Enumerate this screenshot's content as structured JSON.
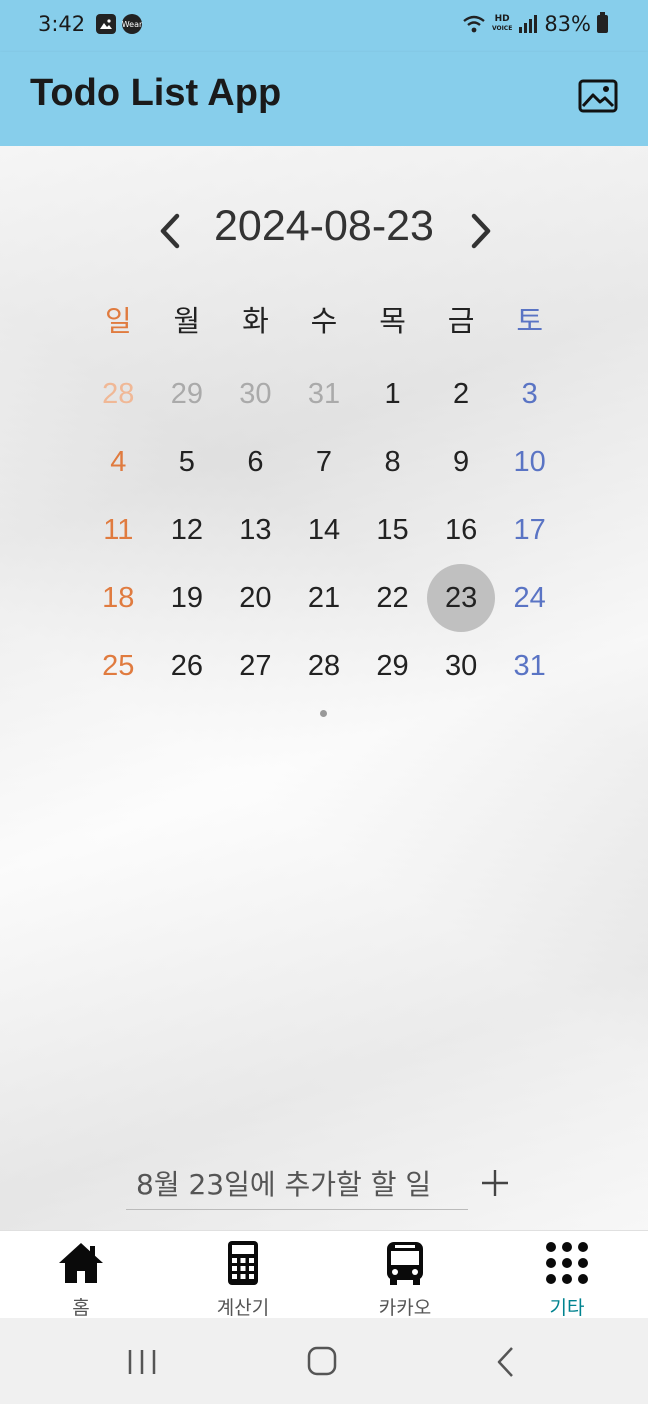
{
  "status_bar": {
    "time": "3:42",
    "battery": "83%",
    "left_icons": [
      "gallery-icon",
      "wear-icon"
    ],
    "wear_label": "Wear",
    "hd_label": "HD",
    "voice_label": "VOICE"
  },
  "app_bar": {
    "title": "Todo List App",
    "action_icon": "image-icon"
  },
  "calendar": {
    "current_date": "2024-08-23",
    "weekdays": [
      "일",
      "월",
      "화",
      "수",
      "목",
      "금",
      "토"
    ],
    "weeks": [
      [
        "28",
        "29",
        "30",
        "31",
        "1",
        "2",
        "3"
      ],
      [
        "4",
        "5",
        "6",
        "7",
        "8",
        "9",
        "10"
      ],
      [
        "11",
        "12",
        "13",
        "14",
        "15",
        "16",
        "17"
      ],
      [
        "18",
        "19",
        "20",
        "21",
        "22",
        "23",
        "24"
      ],
      [
        "25",
        "26",
        "27",
        "28",
        "29",
        "30",
        "31"
      ]
    ],
    "selected_day": "23",
    "colors": {
      "sunday": "#e07b3f",
      "saturday": "#5a74c4",
      "outside_month": "#aaaaaa",
      "selected_bg": "#c0c0c0"
    }
  },
  "todo": {
    "input_placeholder": "8월 23일에 추가할 할 일",
    "add_icon": "plus-icon"
  },
  "bottom_nav": {
    "items": [
      {
        "label": "홈",
        "icon": "home-icon"
      },
      {
        "label": "계산기",
        "icon": "calculator-icon"
      },
      {
        "label": "카카오",
        "icon": "bus-icon"
      },
      {
        "label": "기타",
        "icon": "grid-dots-icon"
      }
    ],
    "active_index": 3,
    "active_color": "#00838f"
  },
  "theme": {
    "app_bar_color": "#87ceeb"
  }
}
